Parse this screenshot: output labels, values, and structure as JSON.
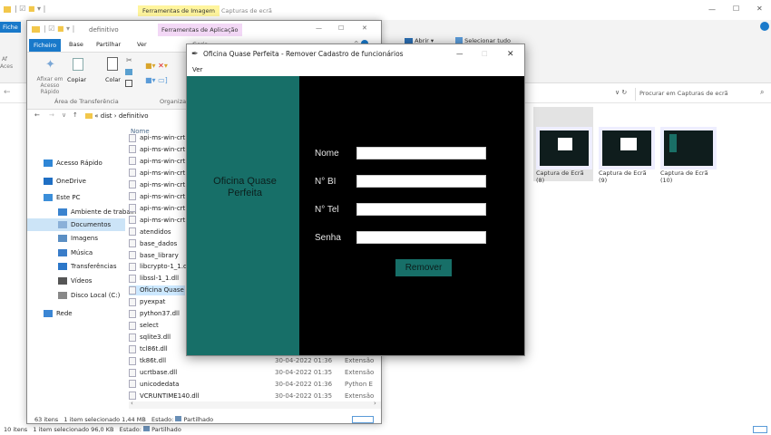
{
  "back": {
    "tab_tools": "Ferramentas de Imagem",
    "tab_context": "Capturas de ecrã",
    "tab_file": "Fiche",
    "ribbon_items": [
      "Abrir ▾",
      "Selecionar tudo"
    ],
    "ribbon_left_small": "Af",
    "ribbon_left_small2": "Aces",
    "search_placeholder": "Procurar em Capturas de ecrã",
    "thumbnails": [
      {
        "caption": "Captura de Ecrã (8)"
      },
      {
        "caption": "Captura de Ecrã (9)"
      },
      {
        "caption": "Captura de Ecrã (10)"
      }
    ],
    "status": {
      "items": "10 itens",
      "selected": "1 item selecionado 96,0 KB",
      "state": "Estado:",
      "shared": "Partilhado"
    }
  },
  "explorer": {
    "title": "definitivo",
    "app_tools_tab": "Ferramentas de Aplicação",
    "manage_tab": "Gerir",
    "tabs": [
      "Ficheiro",
      "Base",
      "Partilhar",
      "Ver"
    ],
    "ribbon": {
      "pin_label": "Afixar em Acesso Rápido",
      "copy_label": "Copiar",
      "paste_label": "Colar",
      "group_clipboard": "Área de Transferência",
      "group_organize": "Organizar"
    },
    "breadcrumb": [
      "«",
      "dist",
      "›",
      "definitivo"
    ],
    "sidebar": [
      {
        "label": "Acesso Rápido",
        "icon": "star-icon",
        "color": "#2f86d6"
      },
      {
        "label": "OneDrive",
        "icon": "cloud-icon",
        "color": "#1f6fc4"
      },
      {
        "label": "Este PC",
        "icon": "pc-icon",
        "color": "#3b8ed9"
      },
      {
        "label": "Ambiente de trabalh",
        "icon": "desktop-icon",
        "color": "#3a83cf"
      },
      {
        "label": "Documentos",
        "icon": "documents-icon",
        "color": "#8ab0d8"
      },
      {
        "label": "Imagens",
        "icon": "images-icon",
        "color": "#5b8fc4"
      },
      {
        "label": "Música",
        "icon": "music-icon",
        "color": "#3a7dc9"
      },
      {
        "label": "Transferências",
        "icon": "download-icon",
        "color": "#2c77c9"
      },
      {
        "label": "Vídeos",
        "icon": "video-icon",
        "color": "#555"
      },
      {
        "label": "Disco Local (C:)",
        "icon": "disk-icon",
        "color": "#888"
      },
      {
        "label": "Rede",
        "icon": "network-icon",
        "color": "#3b86d4"
      }
    ],
    "files_header": "Nome",
    "files": [
      {
        "name": "api-ms-win-crt"
      },
      {
        "name": "api-ms-win-crt"
      },
      {
        "name": "api-ms-win-crt"
      },
      {
        "name": "api-ms-win-crt"
      },
      {
        "name": "api-ms-win-crt"
      },
      {
        "name": "api-ms-win-crt"
      },
      {
        "name": "api-ms-win-crt"
      },
      {
        "name": "api-ms-win-crt"
      },
      {
        "name": "atendidos"
      },
      {
        "name": "base_dados"
      },
      {
        "name": "base_library"
      },
      {
        "name": "libcrypto-1_1.dl"
      },
      {
        "name": "libssl-1_1.dll"
      },
      {
        "name": "Oficina Quase P"
      },
      {
        "name": "pyexpat"
      },
      {
        "name": "python37.dll"
      },
      {
        "name": "select"
      },
      {
        "name": "sqlite3.dll"
      },
      {
        "name": "tcl86t.dll"
      },
      {
        "name": "tk86t.dll",
        "date": "30-04-2022 01:36",
        "type": "Extensão"
      },
      {
        "name": "ucrtbase.dll",
        "date": "30-04-2022 01:35",
        "type": "Extensão"
      },
      {
        "name": "unicodedata",
        "date": "30-04-2022 01:36",
        "type": "Python E"
      },
      {
        "name": "VCRUNTIME140.dll",
        "date": "30-04-2022 01:35",
        "type": "Extensão"
      }
    ],
    "status": {
      "count": "63 itens",
      "selected": "1 item selecionado 1,44 MB",
      "state": "Estado:",
      "shared": "Partilhado"
    }
  },
  "app": {
    "title": "Oficina Quase Perfeita - Remover Cadastro de funcionários",
    "menu": "Ver",
    "brand": "Oficina Quase Perfeita",
    "fields": [
      {
        "label": "Nome",
        "value": ""
      },
      {
        "label": "N° BI",
        "value": ""
      },
      {
        "label": "N° Tel",
        "value": ""
      },
      {
        "label": "Senha",
        "value": ""
      }
    ],
    "remove_label": "Remover",
    "colors": {
      "teal": "#176f68",
      "panel": "#000000"
    }
  },
  "window_controls": {
    "minimize": "—",
    "maximize": "☐",
    "close": "✕"
  }
}
